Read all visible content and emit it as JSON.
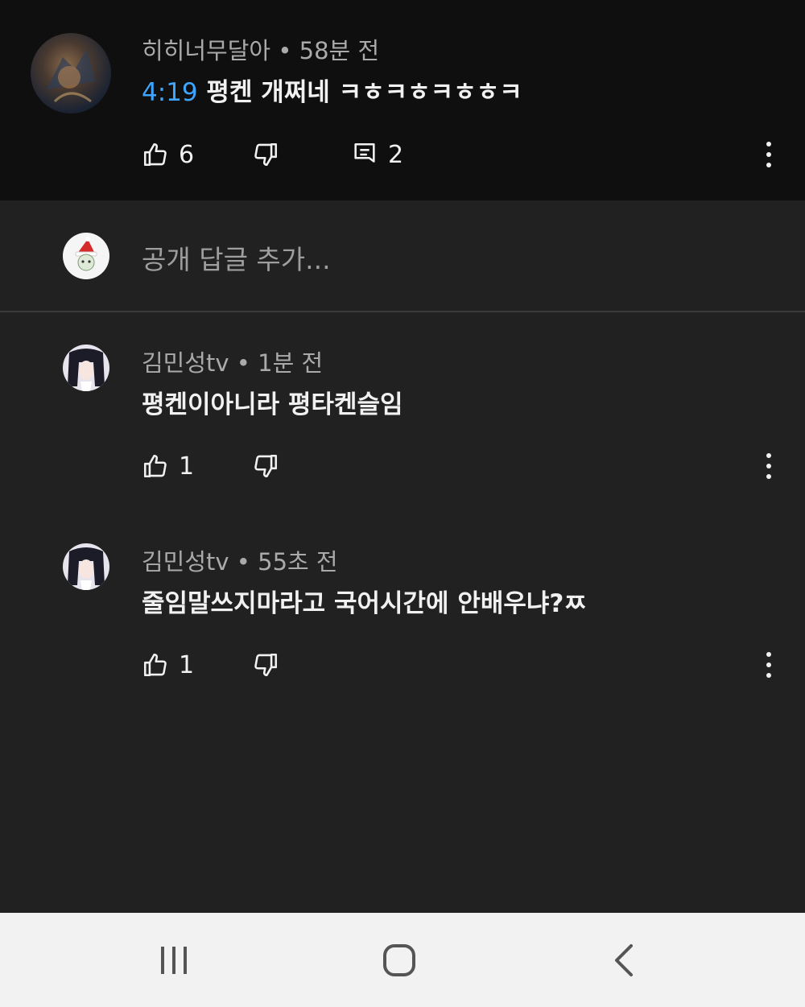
{
  "top_comment": {
    "author": "히히너무달아",
    "age": "58분 전",
    "timestamp_link": "4:19",
    "text": "평켄 개쩌네 ㅋㅎㅋㅎㅋㅎㅎㅋ",
    "like_count": "6",
    "reply_count": "2"
  },
  "reply_box": {
    "placeholder": "공개 답글 추가..."
  },
  "replies": [
    {
      "author": "김민성tv",
      "age": "1분 전",
      "text": "평켄이아니라 평타켄슬임",
      "like_count": "1"
    },
    {
      "author": "김민성tv",
      "age": "55초 전",
      "text": "줄임말쓰지마라고 국어시간에 안배우냐?ㅉ",
      "like_count": "1"
    }
  ],
  "separator": "•",
  "colors": {
    "background": "#212121",
    "top_background": "#0f0f0f",
    "link": "#3ea6ff",
    "navbar": "#f2f2f2"
  },
  "icons": [
    "thumbs-up-icon",
    "thumbs-down-icon",
    "comment-icon",
    "more-vert-icon",
    "recents-icon",
    "home-icon",
    "back-icon"
  ]
}
